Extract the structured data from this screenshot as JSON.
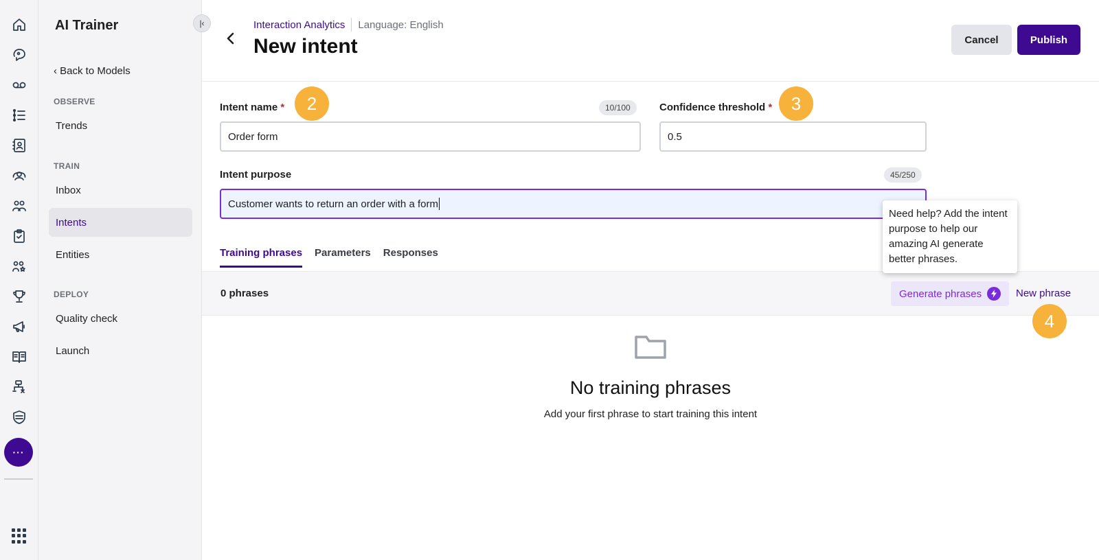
{
  "rail": {
    "icons": [
      "home-icon",
      "chat-bot-icon",
      "voicemail-icon",
      "list-icon",
      "contacts-icon",
      "agent-icon",
      "team-icon",
      "clipboard-icon",
      "users-star-icon",
      "trophy-icon",
      "megaphone-icon",
      "book-icon",
      "workflow-icon",
      "shield-icon"
    ],
    "more_label": "···",
    "apps_icon": "grid-icon"
  },
  "nav": {
    "title": "AI Trainer",
    "back_label": "Back to Models",
    "observe_label": "OBSERVE",
    "trends_label": "Trends",
    "train_label": "TRAIN",
    "inbox_label": "Inbox",
    "intents_label": "Intents",
    "entities_label": "Entities",
    "deploy_label": "DEPLOY",
    "quality_label": "Quality check",
    "launch_label": "Launch",
    "collapse_icon": "collapse-icon"
  },
  "header": {
    "breadcrumb_link": "Interaction Analytics",
    "language": "Language: English",
    "title": "New intent",
    "cancel_label": "Cancel",
    "publish_label": "Publish"
  },
  "form": {
    "intent_name_label": "Intent name",
    "required_mark": "*",
    "intent_name_counter": "10/100",
    "intent_name_value": "Order form",
    "confidence_label": "Confidence threshold",
    "confidence_value": "0.5",
    "purpose_label": "Intent purpose",
    "purpose_counter": "45/250",
    "purpose_value": "Customer wants to return an order with a form"
  },
  "badges": {
    "step2": "2",
    "step3": "3",
    "step4": "4"
  },
  "tooltip": {
    "text": "Need help? Add the intent purpose to help our amazing AI generate better phrases."
  },
  "tabs": {
    "training": "Training phrases",
    "parameters": "Parameters",
    "responses": "Responses",
    "active": "Training phrases"
  },
  "phrases": {
    "count": "0 phrases",
    "generate_label": "Generate phrases",
    "new_label": "New phrase"
  },
  "empty": {
    "title": "No training phrases",
    "subtitle": "Add your first phrase to start training this intent"
  },
  "colors": {
    "brand": "#3d0a91",
    "accent": "#7a2bdb",
    "badge": "#f7b23b",
    "required": "#d61f2b"
  }
}
